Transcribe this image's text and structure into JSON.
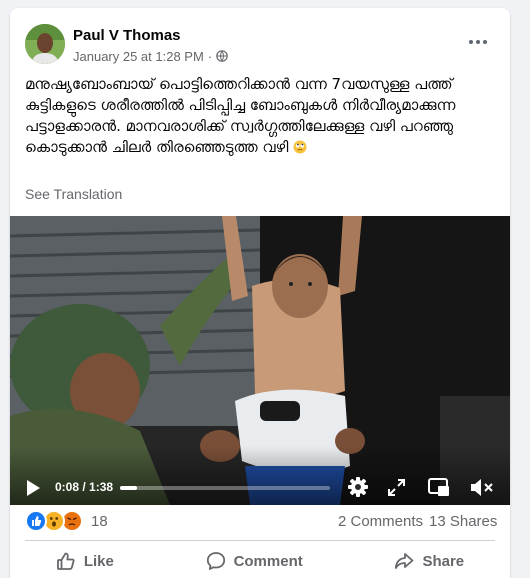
{
  "post": {
    "author": "Paul V Thomas",
    "date": "January 25 at 1:28 PM",
    "separator": "·",
    "privacy_icon": "globe-icon",
    "text": "മനുഷ്യബോംബായ് പൊട്ടിത്തെറിക്കാൻ വന്ന 7വയസുള്ള പത്ത് കുട്ടികളുടെ ശരീരത്തിൽ പിടിപ്പിച്ച ബോംബുകൾ നിർവീര്യമാക്കുന്ന പട്ടാളക്കാരൻ. മാനവരാശിക്ക് സ്വർഗ്ഗത്തിലേക്കുള്ള വഴി പറഞ്ഞു കൊടുക്കാൻ ചിലർ തിരഞ്ഞെടുത്ത വഴി",
    "see_translation": "See Translation"
  },
  "video": {
    "time": "0:08 / 1:38",
    "progress": 0.082
  },
  "stats": {
    "reaction_count": "18",
    "reactions": [
      "like",
      "wow",
      "angry"
    ],
    "comments": "2 Comments",
    "shares": "13 Shares"
  },
  "actions": {
    "like": "Like",
    "comment": "Comment",
    "share": "Share"
  },
  "colors": {
    "like_blue": "#1877f2",
    "wow_yellow": "#f7b125",
    "angry_orange": "#e9710f",
    "secondary_text": "#65676b"
  }
}
